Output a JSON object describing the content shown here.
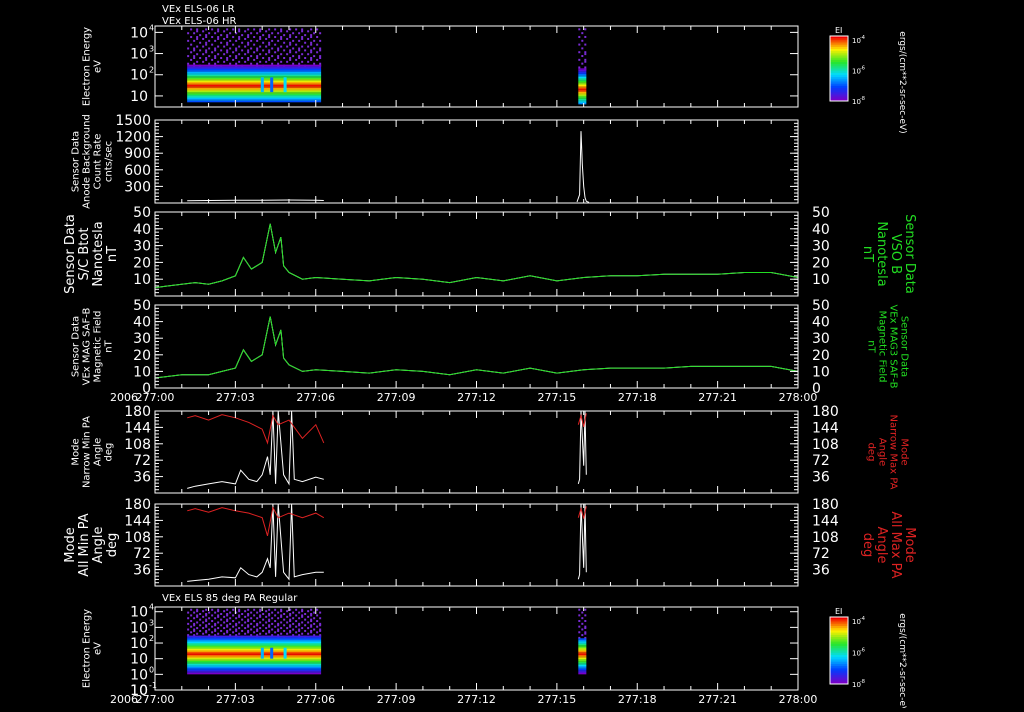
{
  "colors": {
    "background": "#000000",
    "axes": "#ffffff",
    "trace_white": "#ffffff",
    "trace_green": "#22dd22",
    "trace_red": "#dd2222",
    "label_green": "#22dd22",
    "label_red": "#dd2222"
  },
  "colorbar_unit": "ergs/(cm**2-sr-sec-eV)",
  "chart_data": [
    {
      "id": "panel1",
      "type": "heatmap",
      "title_lines": [
        "VEx ELS-06 LR",
        "VEx ELS-06 HR"
      ],
      "ylabel_lines": [
        "Electron Energy",
        "eV"
      ],
      "ytick_labels": [
        "10",
        "10",
        "10",
        "10"
      ],
      "ytick_exponents": [
        "4",
        "3",
        "2",
        ""
      ],
      "ytick_values": [
        10000,
        1000,
        100,
        10
      ],
      "ylim": [
        3,
        20000
      ],
      "yscale": "log",
      "intervals": [
        {
          "x_start": "277:01.2",
          "x_end": "277:06.2",
          "e_low": 5,
          "e_high": 300,
          "peak_energy": 30
        },
        {
          "x_start": "277:15.8",
          "x_end": "277:16.1",
          "e_low": 4,
          "e_high": 200,
          "peak_energy": 20
        }
      ],
      "colorbar": {
        "label": "EI",
        "tick_labels": [
          "10",
          "10",
          "10"
        ],
        "tick_exponents": [
          "-4",
          "-6",
          "-8"
        ]
      }
    },
    {
      "id": "panel2",
      "type": "line",
      "ylabel_lines": [
        "Sensor Data",
        "Anode Background",
        "Count Rate",
        "cnts/sec"
      ],
      "yticks": [
        300,
        600,
        900,
        1200,
        1500
      ],
      "ylim": [
        0,
        1500
      ],
      "series": [
        {
          "color": "white",
          "x": [
            "277:01.2",
            "277:02.0",
            "277:03.0",
            "277:04.0",
            "277:05.0",
            "277:06.0",
            "277:06.3"
          ],
          "y": [
            40,
            45,
            50,
            50,
            55,
            50,
            45
          ]
        },
        {
          "color": "white",
          "x": [
            "277:15.75",
            "277:15.85",
            "277:15.9",
            "277:15.95",
            "277:16.0",
            "277:16.05",
            "277:16.1",
            "277:16.2"
          ],
          "y": [
            20,
            150,
            1300,
            700,
            300,
            100,
            30,
            10
          ]
        }
      ]
    },
    {
      "id": "panel3",
      "type": "line",
      "ylabel_lines": [
        "Sensor Data",
        "S/C Btot",
        "Nanotesla",
        "nT"
      ],
      "right_ylabel_lines": [
        "Sensor Data",
        "VSO B",
        "Nanotesla",
        "nT"
      ],
      "yticks": [
        10,
        20,
        30,
        40,
        50
      ],
      "ylim": [
        0,
        50
      ],
      "series": [
        {
          "color": "white",
          "x": [
            "277:00",
            "277:00.5",
            "277:01",
            "277:01.5",
            "277:02",
            "277:02.5",
            "277:03",
            "277:03.3",
            "277:03.6",
            "277:04",
            "277:04.3",
            "277:04.5",
            "277:04.7",
            "277:04.8",
            "277:05",
            "277:05.5",
            "277:06",
            "277:07",
            "277:08",
            "277:09",
            "277:10",
            "277:11",
            "277:12",
            "277:13",
            "277:14",
            "277:15",
            "277:16",
            "277:17",
            "277:18",
            "277:19",
            "277:20",
            "277:21",
            "277:22",
            "277:23",
            "277:24"
          ],
          "y": [
            5,
            6,
            7,
            8,
            7,
            9,
            12,
            23,
            16,
            20,
            43,
            26,
            35,
            18,
            14,
            10,
            11,
            10,
            9,
            11,
            10,
            8,
            11,
            9,
            12,
            9,
            11,
            12,
            12,
            13,
            13,
            13,
            14,
            14,
            11
          ]
        },
        {
          "color": "green",
          "x": [
            "277:00",
            "277:00.5",
            "277:01",
            "277:01.5",
            "277:02",
            "277:02.5",
            "277:03",
            "277:03.3",
            "277:03.6",
            "277:04",
            "277:04.3",
            "277:04.5",
            "277:04.7",
            "277:04.8",
            "277:05",
            "277:05.5",
            "277:06",
            "277:07",
            "277:08",
            "277:09",
            "277:10",
            "277:11",
            "277:12",
            "277:13",
            "277:14",
            "277:15",
            "277:16",
            "277:17",
            "277:18",
            "277:19",
            "277:20",
            "277:21",
            "277:22",
            "277:23",
            "277:24"
          ],
          "y": [
            5,
            6,
            7,
            8,
            7,
            9,
            12,
            23,
            16,
            20,
            43,
            26,
            35,
            18,
            14,
            10,
            11,
            10,
            9,
            11,
            10,
            8,
            11,
            9,
            12,
            9,
            11,
            12,
            12,
            13,
            13,
            13,
            14,
            14,
            11
          ]
        }
      ]
    },
    {
      "id": "panel4",
      "type": "line",
      "ylabel_lines": [
        "Sensor Data",
        "VEx MAG SAF-B",
        "Magnetic Field",
        "nT"
      ],
      "right_ylabel_lines": [
        "Sensor Data",
        "VEx MAG3 SAF-B",
        "Magnetic Field",
        "nT"
      ],
      "yticks": [
        0,
        10,
        20,
        30,
        40,
        50
      ],
      "ylim": [
        0,
        50
      ],
      "series": [
        {
          "color": "white",
          "x": [
            "277:00",
            "277:00.5",
            "277:01",
            "277:01.5",
            "277:02",
            "277:02.5",
            "277:03",
            "277:03.3",
            "277:03.6",
            "277:04",
            "277:04.3",
            "277:04.5",
            "277:04.7",
            "277:04.8",
            "277:05",
            "277:05.5",
            "277:06",
            "277:07",
            "277:08",
            "277:09",
            "277:10",
            "277:11",
            "277:12",
            "277:13",
            "277:14",
            "277:15",
            "277:16",
            "277:17",
            "277:18",
            "277:19",
            "277:20",
            "277:21",
            "277:22",
            "277:23",
            "277:24"
          ],
          "y": [
            6,
            7,
            8,
            8,
            8,
            10,
            12,
            23,
            16,
            20,
            43,
            26,
            35,
            18,
            14,
            10,
            11,
            10,
            9,
            11,
            10,
            8,
            11,
            9,
            12,
            9,
            11,
            12,
            12,
            12,
            13,
            13,
            13,
            13,
            10
          ]
        },
        {
          "color": "green",
          "x": [
            "277:00",
            "277:00.5",
            "277:01",
            "277:01.5",
            "277:02",
            "277:02.5",
            "277:03",
            "277:03.3",
            "277:03.6",
            "277:04",
            "277:04.3",
            "277:04.5",
            "277:04.7",
            "277:04.8",
            "277:05",
            "277:05.5",
            "277:06",
            "277:07",
            "277:08",
            "277:09",
            "277:10",
            "277:11",
            "277:12",
            "277:13",
            "277:14",
            "277:15",
            "277:16",
            "277:17",
            "277:18",
            "277:19",
            "277:20",
            "277:21",
            "277:22",
            "277:23",
            "277:24"
          ],
          "y": [
            6,
            7,
            8,
            8,
            8,
            10,
            12,
            23,
            16,
            20,
            43,
            26,
            35,
            18,
            14,
            10,
            11,
            10,
            9,
            11,
            10,
            8,
            11,
            9,
            12,
            9,
            11,
            12,
            12,
            12,
            13,
            13,
            13,
            13,
            10
          ]
        }
      ]
    },
    {
      "id": "panel5",
      "type": "line",
      "ylabel_lines": [
        "Mode",
        "Narrow Min PA",
        "Angle",
        "deg"
      ],
      "right_ylabel_lines": [
        "Mode",
        "Narrow Max PA",
        "Angle",
        "deg"
      ],
      "yticks": [
        36,
        72,
        108,
        144,
        180
      ],
      "ylim": [
        0,
        180
      ],
      "series": [
        {
          "color": "white",
          "x": [
            "277:01.2",
            "277:01.5",
            "277:02.0",
            "277:02.5",
            "277:03.0",
            "277:03.2",
            "277:03.5",
            "277:03.8",
            "277:04.0",
            "277:04.2",
            "277:04.3",
            "277:04.4",
            "277:04.5",
            "277:04.6",
            "277:04.8",
            "277:05.0",
            "277:05.1",
            "277:05.2",
            "277:05.5",
            "277:06.0",
            "277:06.3"
          ],
          "y": [
            10,
            15,
            20,
            25,
            20,
            50,
            30,
            25,
            40,
            80,
            40,
            180,
            20,
            180,
            40,
            20,
            180,
            30,
            25,
            35,
            30
          ]
        },
        {
          "color": "red",
          "x": [
            "277:01.2",
            "277:01.5",
            "277:02.0",
            "277:02.5",
            "277:03.0",
            "277:03.5",
            "277:04.0",
            "277:04.2",
            "277:04.4",
            "277:04.6",
            "277:05.0",
            "277:05.5",
            "277:06.0",
            "277:06.3"
          ],
          "y": [
            165,
            170,
            160,
            172,
            165,
            155,
            140,
            110,
            170,
            150,
            160,
            120,
            150,
            110
          ]
        },
        {
          "color": "white",
          "x": [
            "277:15.8",
            "277:15.85",
            "277:15.9",
            "277:16.0",
            "277:16.05",
            "277:16.1"
          ],
          "y": [
            20,
            30,
            180,
            60,
            180,
            40
          ]
        },
        {
          "color": "red",
          "x": [
            "277:15.8",
            "277:15.9",
            "277:16.0",
            "277:16.1"
          ],
          "y": [
            150,
            170,
            145,
            175
          ]
        }
      ]
    },
    {
      "id": "panel6",
      "type": "line",
      "ylabel_lines": [
        "Mode",
        "All Min PA",
        "Angle",
        "deg"
      ],
      "right_ylabel_lines": [
        "Mode",
        "All Max PA",
        "Angle",
        "deg"
      ],
      "yticks": [
        36,
        72,
        108,
        144,
        180
      ],
      "ylim": [
        0,
        180
      ],
      "series": [
        {
          "color": "white",
          "x": [
            "277:01.2",
            "277:01.5",
            "277:02.0",
            "277:02.5",
            "277:03.0",
            "277:03.2",
            "277:03.5",
            "277:03.8",
            "277:04.0",
            "277:04.2",
            "277:04.3",
            "277:04.4",
            "277:04.5",
            "277:04.6",
            "277:04.8",
            "277:05.0",
            "277:05.1",
            "277:05.2",
            "277:05.5",
            "277:06.0",
            "277:06.3"
          ],
          "y": [
            10,
            12,
            15,
            20,
            18,
            40,
            25,
            20,
            30,
            60,
            40,
            180,
            20,
            180,
            30,
            15,
            180,
            20,
            25,
            30,
            30
          ]
        },
        {
          "color": "red",
          "x": [
            "277:01.2",
            "277:01.5",
            "277:02.0",
            "277:02.5",
            "277:03.0",
            "277:03.5",
            "277:04.0",
            "277:04.2",
            "277:04.4",
            "277:04.6",
            "277:05.0",
            "277:05.5",
            "277:06.0",
            "277:06.3"
          ],
          "y": [
            165,
            170,
            162,
            172,
            165,
            160,
            150,
            110,
            172,
            150,
            160,
            150,
            160,
            150
          ]
        },
        {
          "color": "white",
          "x": [
            "277:15.8",
            "277:15.85",
            "277:15.9",
            "277:16.0",
            "277:16.05",
            "277:16.1"
          ],
          "y": [
            15,
            25,
            180,
            40,
            180,
            30
          ]
        },
        {
          "color": "red",
          "x": [
            "277:15.8",
            "277:15.9",
            "277:16.0",
            "277:16.1"
          ],
          "y": [
            150,
            170,
            148,
            175
          ]
        }
      ]
    },
    {
      "id": "panel7",
      "type": "heatmap",
      "title_lines": [
        "VEx ELS 85 deg PA Regular"
      ],
      "ylabel_lines": [
        "Electron Energy",
        "eV"
      ],
      "ytick_labels": [
        "10",
        "10",
        "10",
        "10",
        "10",
        "10",
        "10"
      ],
      "ytick_exponents": [
        "4",
        "3",
        "2",
        "",
        "0",
        "-1",
        ""
      ],
      "ytick_values": [
        10000,
        1000,
        100,
        10,
        1,
        0.1,
        0.1
      ],
      "ylim": [
        0.1,
        20000
      ],
      "yscale": "log",
      "intervals": [
        {
          "x_start": "277:01.2",
          "x_end": "277:06.2",
          "e_low": 1,
          "e_high": 300,
          "peak_energy": 20
        },
        {
          "x_start": "277:15.8",
          "x_end": "277:16.1",
          "e_low": 1,
          "e_high": 200,
          "peak_energy": 20
        }
      ],
      "colorbar": {
        "label": "EI",
        "tick_labels": [
          "10",
          "10",
          "10"
        ],
        "tick_exponents": [
          "-4",
          "-6",
          "-8"
        ]
      }
    }
  ],
  "time_axis": {
    "year_label": "2006",
    "tick_labels": [
      "277:00",
      "277:03",
      "277:06",
      "277:09",
      "277:12",
      "277:15",
      "277:18",
      "277:21",
      "278:00"
    ],
    "xlim": [
      "277:00",
      "278:00"
    ]
  }
}
